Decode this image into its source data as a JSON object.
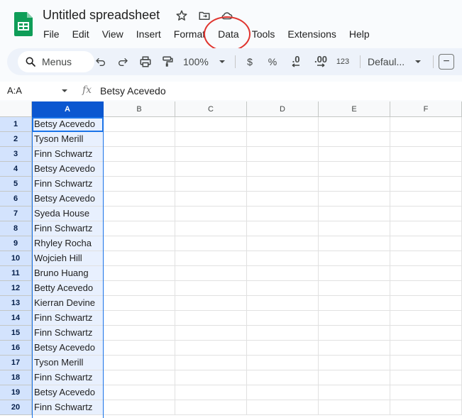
{
  "document": {
    "title": "Untitled spreadsheet"
  },
  "menubar": [
    "File",
    "Edit",
    "View",
    "Insert",
    "Format",
    "Data",
    "Tools",
    "Extensions",
    "Help"
  ],
  "toolbar": {
    "search_label": "Menus",
    "zoom": "100%",
    "currency": "$",
    "percent": "%",
    "decrease_decimal": ".0",
    "increase_decimal": ".00",
    "number_format": "123",
    "font": "Defaul...",
    "font_size_minus": "−"
  },
  "formula_bar": {
    "name_box": "A:A",
    "fx": "fx",
    "value": "Betsy Acevedo"
  },
  "sheet": {
    "columns": [
      "A",
      "B",
      "C",
      "D",
      "E",
      "F"
    ],
    "rows": [
      {
        "n": "1",
        "a": "Betsy Acevedo"
      },
      {
        "n": "2",
        "a": "Tyson Merill"
      },
      {
        "n": "3",
        "a": "Finn Schwartz"
      },
      {
        "n": "4",
        "a": "Betsy Acevedo"
      },
      {
        "n": "5",
        "a": "Finn Schwartz"
      },
      {
        "n": "6",
        "a": "Betsy Acevedo"
      },
      {
        "n": "7",
        "a": "Syeda House"
      },
      {
        "n": "8",
        "a": "Finn Schwartz"
      },
      {
        "n": "9",
        "a": "Rhyley Rocha"
      },
      {
        "n": "10",
        "a": "Wojcieh Hill"
      },
      {
        "n": "11",
        "a": "Bruno Huang"
      },
      {
        "n": "12",
        "a": "Betty Acevedo"
      },
      {
        "n": "13",
        "a": "Kierran Devine"
      },
      {
        "n": "14",
        "a": "Finn Schwartz"
      },
      {
        "n": "15",
        "a": "Finn Schwartz"
      },
      {
        "n": "16",
        "a": "Betsy Acevedo"
      },
      {
        "n": "17",
        "a": "Tyson Merill"
      },
      {
        "n": "18",
        "a": "Finn Schwartz"
      },
      {
        "n": "19",
        "a": "Betsy Acevedo"
      },
      {
        "n": "20",
        "a": "Finn Schwartz"
      }
    ]
  },
  "colors": {
    "accent": "#1a73e8",
    "selected_header": "#0b57d0",
    "annotation": "#e0352f",
    "sheets_green": "#0f9d58"
  }
}
